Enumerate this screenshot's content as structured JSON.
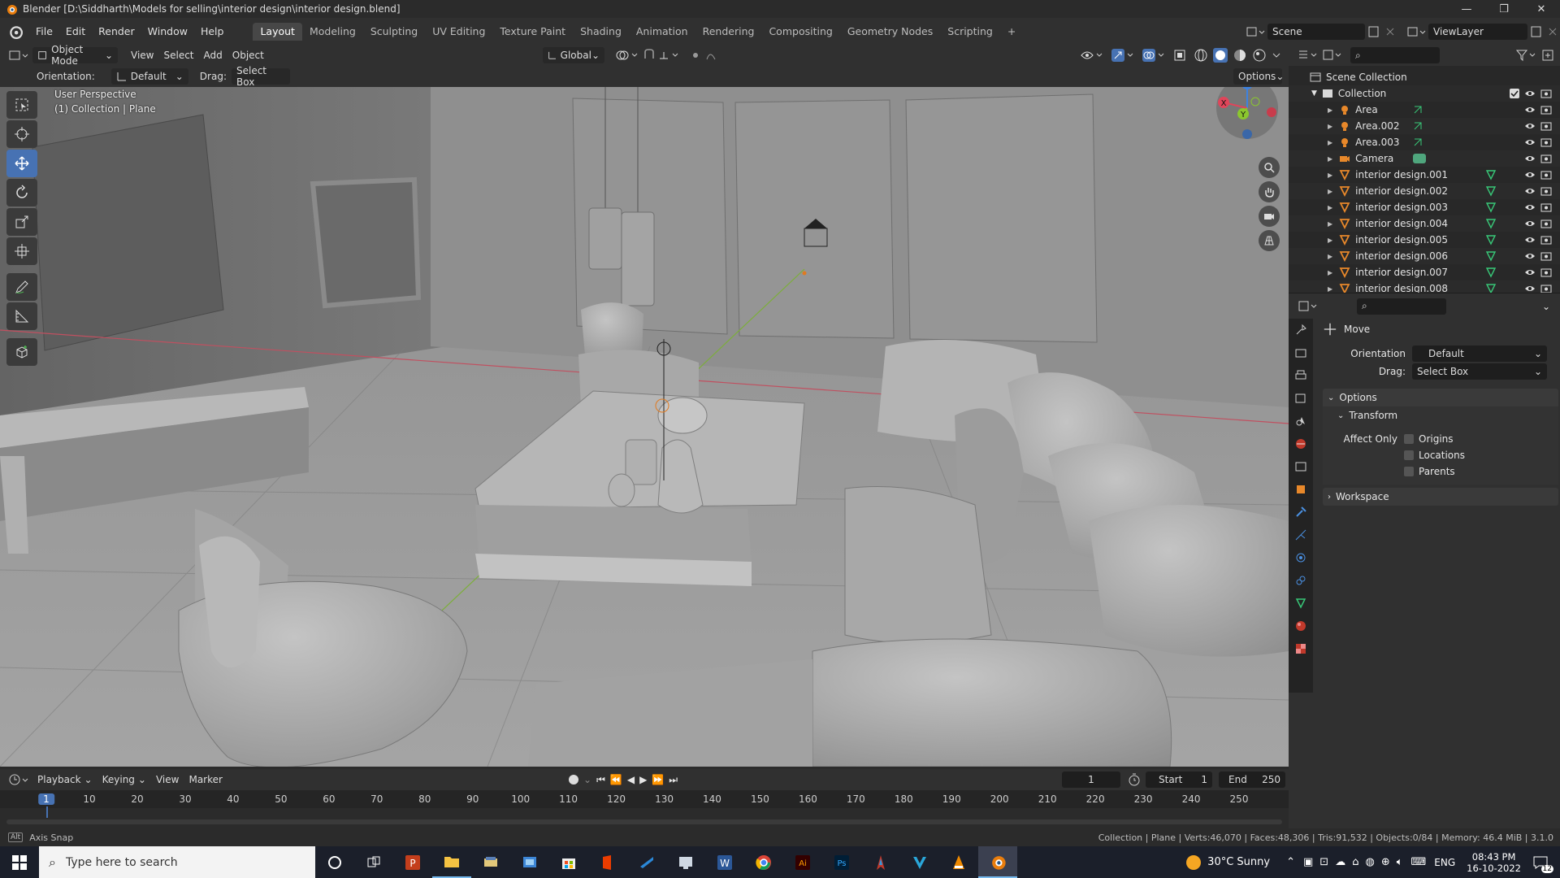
{
  "window": {
    "title": "Blender [D:\\Siddharth\\Models for selling\\interior design\\interior design.blend]"
  },
  "menu": [
    "File",
    "Edit",
    "Render",
    "Window",
    "Help"
  ],
  "workspaces": [
    "Layout",
    "Modeling",
    "Sculpting",
    "UV Editing",
    "Texture Paint",
    "Shading",
    "Animation",
    "Rendering",
    "Compositing",
    "Geometry Nodes",
    "Scripting"
  ],
  "active_workspace": "Layout",
  "scene": {
    "name": "Scene",
    "view_layer": "ViewLayer"
  },
  "viewport_header": {
    "mode": "Object Mode",
    "menus": [
      "View",
      "Select",
      "Add",
      "Object"
    ],
    "transform_orientation": "Global"
  },
  "tool_header": {
    "orientation_label": "Orientation:",
    "orientation_value": "Default",
    "drag_label": "Drag:",
    "drag_value": "Select Box",
    "options_label": "Options"
  },
  "viewport": {
    "perspective": "User Perspective",
    "collection_info": "(1) Collection | Plane"
  },
  "outliner": {
    "scene_collection": "Scene Collection",
    "collection": "Collection",
    "items": [
      {
        "name": "Area",
        "type": "light"
      },
      {
        "name": "Area.002",
        "type": "light"
      },
      {
        "name": "Area.003",
        "type": "light"
      },
      {
        "name": "Camera",
        "type": "camera"
      },
      {
        "name": "interior design.001",
        "type": "mesh"
      },
      {
        "name": "interior design.002",
        "type": "mesh"
      },
      {
        "name": "interior design.003",
        "type": "mesh"
      },
      {
        "name": "interior design.004",
        "type": "mesh"
      },
      {
        "name": "interior design.005",
        "type": "mesh"
      },
      {
        "name": "interior design.006",
        "type": "mesh"
      },
      {
        "name": "interior design.007",
        "type": "mesh"
      },
      {
        "name": "interior design.008",
        "type": "mesh"
      }
    ]
  },
  "properties": {
    "tool_name": "Move",
    "orientation_label": "Orientation",
    "orientation_value": "Default",
    "drag_label": "Drag:",
    "drag_value": "Select Box",
    "options_panel": "Options",
    "transform_panel": "Transform",
    "affect_only_label": "Affect Only",
    "checkboxes": [
      "Origins",
      "Locations",
      "Parents"
    ],
    "workspace_panel": "Workspace"
  },
  "timeline": {
    "menus": [
      "Playback",
      "Keying",
      "View",
      "Marker"
    ],
    "current_frame": "1",
    "start_label": "Start",
    "start": "1",
    "end_label": "End",
    "end": "250",
    "ticks": [
      "1",
      "10",
      "20",
      "30",
      "40",
      "50",
      "60",
      "70",
      "80",
      "90",
      "100",
      "110",
      "120",
      "130",
      "140",
      "150",
      "160",
      "170",
      "180",
      "190",
      "200",
      "210",
      "220",
      "230",
      "240",
      "250"
    ]
  },
  "status_bar": {
    "left": "Axis Snap",
    "right": "Collection | Plane | Verts:46,070 | Faces:48,306 | Tris:91,532 | Objects:0/84 | Memory: 46.4 MiB | 3.1.0"
  },
  "taskbar": {
    "search_placeholder": "Type here to search",
    "weather": "30°C  Sunny",
    "language": "ENG",
    "time": "08:43 PM",
    "date": "16-10-2022",
    "notification_count": "12"
  },
  "colors": {
    "accent": "#4772b3",
    "mesh_icon": "#f0a030",
    "data_icon": "#38c878",
    "axis_x": "#e0455a",
    "axis_y": "#8bc72e",
    "axis_z": "#3d82e0"
  }
}
